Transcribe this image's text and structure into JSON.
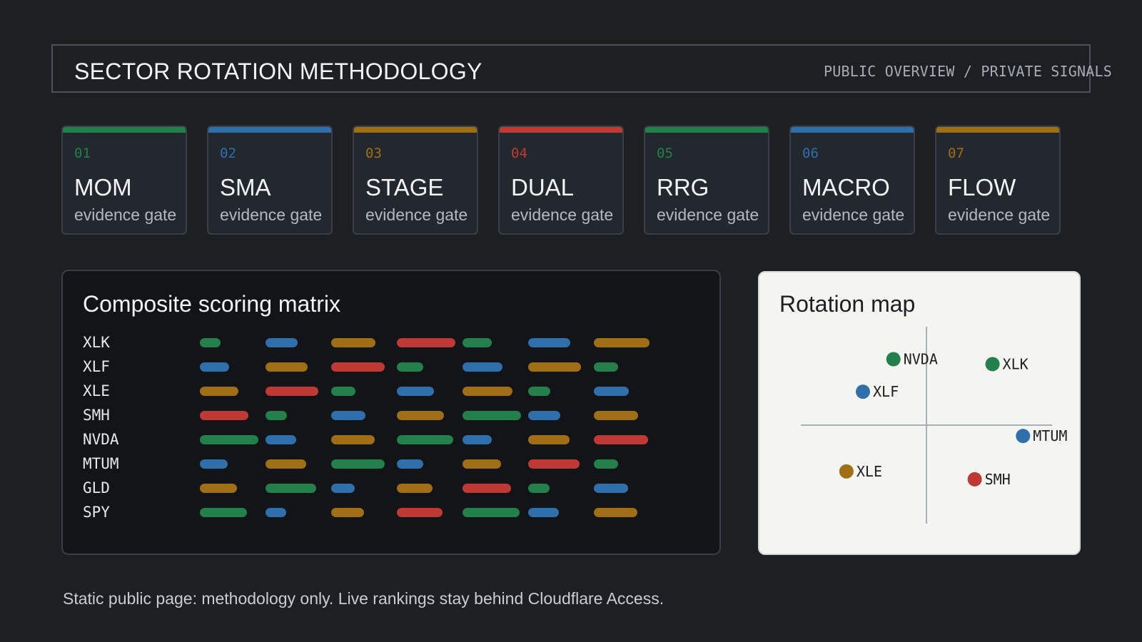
{
  "header": {
    "title": "SECTOR ROTATION METHODOLOGY",
    "subtitle": "PUBLIC OVERVIEW / PRIVATE SIGNALS"
  },
  "colors": {
    "green": "#23804a",
    "blue": "#2f6fac",
    "gold": "#a06f15",
    "red": "#bf3a34"
  },
  "gates": [
    {
      "num": "01",
      "name": "MOM",
      "desc": "evidence gate",
      "color": "green"
    },
    {
      "num": "02",
      "name": "SMA",
      "desc": "evidence gate",
      "color": "blue"
    },
    {
      "num": "03",
      "name": "STAGE",
      "desc": "evidence gate",
      "color": "gold"
    },
    {
      "num": "04",
      "name": "DUAL",
      "desc": "evidence gate",
      "color": "red"
    },
    {
      "num": "05",
      "name": "RRG",
      "desc": "evidence gate",
      "color": "green"
    },
    {
      "num": "06",
      "name": "MACRO",
      "desc": "evidence gate",
      "color": "blue"
    },
    {
      "num": "07",
      "name": "FLOW",
      "desc": "evidence gate",
      "color": "gold"
    }
  ],
  "matrix": {
    "title": "Composite scoring matrix",
    "rows": [
      {
        "label": "XLK",
        "cells": [
          {
            "c": "green",
            "v": 0.35
          },
          {
            "c": "blue",
            "v": 0.55
          },
          {
            "c": "gold",
            "v": 0.75
          },
          {
            "c": "red",
            "v": 1.0
          },
          {
            "c": "green",
            "v": 0.5
          },
          {
            "c": "blue",
            "v": 0.72
          },
          {
            "c": "gold",
            "v": 0.95
          }
        ]
      },
      {
        "label": "XLF",
        "cells": [
          {
            "c": "blue",
            "v": 0.5
          },
          {
            "c": "gold",
            "v": 0.72
          },
          {
            "c": "red",
            "v": 0.92
          },
          {
            "c": "green",
            "v": 0.45
          },
          {
            "c": "blue",
            "v": 0.68
          },
          {
            "c": "gold",
            "v": 0.9
          },
          {
            "c": "green",
            "v": 0.42
          }
        ]
      },
      {
        "label": "XLE",
        "cells": [
          {
            "c": "gold",
            "v": 0.66
          },
          {
            "c": "red",
            "v": 0.9
          },
          {
            "c": "green",
            "v": 0.41
          },
          {
            "c": "blue",
            "v": 0.63
          },
          {
            "c": "gold",
            "v": 0.85
          },
          {
            "c": "green",
            "v": 0.38
          },
          {
            "c": "blue",
            "v": 0.6
          }
        ]
      },
      {
        "label": "SMH",
        "cells": [
          {
            "c": "red",
            "v": 0.83
          },
          {
            "c": "green",
            "v": 0.37
          },
          {
            "c": "blue",
            "v": 0.58
          },
          {
            "c": "gold",
            "v": 0.8
          },
          {
            "c": "green",
            "v": 1.0
          },
          {
            "c": "blue",
            "v": 0.55
          },
          {
            "c": "gold",
            "v": 0.76
          }
        ]
      },
      {
        "label": "NVDA",
        "cells": [
          {
            "c": "green",
            "v": 1.0
          },
          {
            "c": "blue",
            "v": 0.53
          },
          {
            "c": "gold",
            "v": 0.74
          },
          {
            "c": "green",
            "v": 0.96
          },
          {
            "c": "blue",
            "v": 0.5
          },
          {
            "c": "gold",
            "v": 0.71
          },
          {
            "c": "red",
            "v": 0.93
          }
        ]
      },
      {
        "label": "MTUM",
        "cells": [
          {
            "c": "blue",
            "v": 0.48
          },
          {
            "c": "gold",
            "v": 0.7
          },
          {
            "c": "green",
            "v": 0.91
          },
          {
            "c": "blue",
            "v": 0.45
          },
          {
            "c": "gold",
            "v": 0.66
          },
          {
            "c": "red",
            "v": 0.88
          },
          {
            "c": "green",
            "v": 0.41
          }
        ]
      },
      {
        "label": "GLD",
        "cells": [
          {
            "c": "gold",
            "v": 0.64
          },
          {
            "c": "green",
            "v": 0.86
          },
          {
            "c": "blue",
            "v": 0.4
          },
          {
            "c": "gold",
            "v": 0.61
          },
          {
            "c": "red",
            "v": 0.83
          },
          {
            "c": "green",
            "v": 0.37
          },
          {
            "c": "blue",
            "v": 0.58
          }
        ]
      },
      {
        "label": "SPY",
        "cells": [
          {
            "c": "green",
            "v": 0.81
          },
          {
            "c": "blue",
            "v": 0.35
          },
          {
            "c": "gold",
            "v": 0.56
          },
          {
            "c": "red",
            "v": 0.78
          },
          {
            "c": "green",
            "v": 0.98
          },
          {
            "c": "blue",
            "v": 0.53
          },
          {
            "c": "gold",
            "v": 0.74
          }
        ]
      }
    ]
  },
  "rotation": {
    "title": "Rotation map",
    "points": [
      {
        "label": "NVDA",
        "x": -0.26,
        "y": 0.67,
        "color": "green"
      },
      {
        "label": "XLK",
        "x": 0.52,
        "y": 0.62,
        "color": "green"
      },
      {
        "label": "XLF",
        "x": -0.5,
        "y": 0.34,
        "color": "blue"
      },
      {
        "label": "MTUM",
        "x": 0.76,
        "y": -0.11,
        "color": "blue"
      },
      {
        "label": "XLE",
        "x": -0.63,
        "y": -0.47,
        "color": "gold"
      },
      {
        "label": "SMH",
        "x": 0.38,
        "y": -0.55,
        "color": "red"
      }
    ]
  },
  "footer": "Static public page: methodology only. Live rankings stay behind Cloudflare Access."
}
